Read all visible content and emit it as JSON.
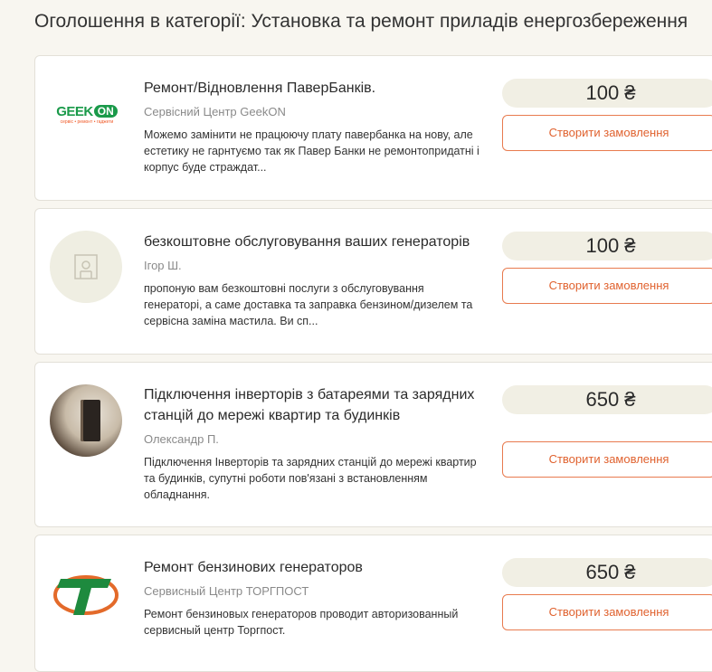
{
  "page": {
    "title": "Оголошення в категорії: Установка та ремонт приладів енергозбереження"
  },
  "listings": [
    {
      "title": "Ремонт/Відновлення ПаверБанків.",
      "author": "Сервісний Центр GeekON",
      "description": "Можемо замінити не працюючу плату павербанка на нову, але естетику не гарнтуємо так як Павер Банки не ремонтопридатні і корпус буде страждат...",
      "price": "100 ₴",
      "order_label": "Створити замовлення",
      "logo_text": "GEEK",
      "logo_text_2": "ON",
      "logo_tagline": "сервіс • ремонт • гаджети"
    },
    {
      "title": "безкоштовне обслуговування ваших генераторів",
      "author": "Ігор Ш.",
      "description": "пропоную вам безкоштовні послуги з обслуговування генераторі, а саме доставка та заправка бензином/дизелем та сервісна заміна мастила. Ви сп...",
      "price": "100 ₴",
      "order_label": "Створити замовлення"
    },
    {
      "title": "Підключення інверторів з батареями та зарядних станцій до мережі квартир та будинків",
      "author": "Олександр П.",
      "description": "Підключення Інверторів та зарядних станцій до мережі квартир та будинків, супутні роботи пов'язані з встановленням обладнання.",
      "price": "650 ₴",
      "order_label": "Створити замовлення"
    },
    {
      "title": "Ремонт бензинових генераторов",
      "author": "Сервисный Центр ТОРГПОСТ",
      "description": "Ремонт бензиновых генераторов проводит авторизованный сервисный центр Торгпост.",
      "price": "650 ₴",
      "order_label": "Створити замовлення"
    }
  ],
  "colors": {
    "accent": "#e0622f",
    "price_bg": "#f1efe4",
    "geekon_green": "#1a9a4a",
    "geekon_orange": "#f05a28"
  }
}
